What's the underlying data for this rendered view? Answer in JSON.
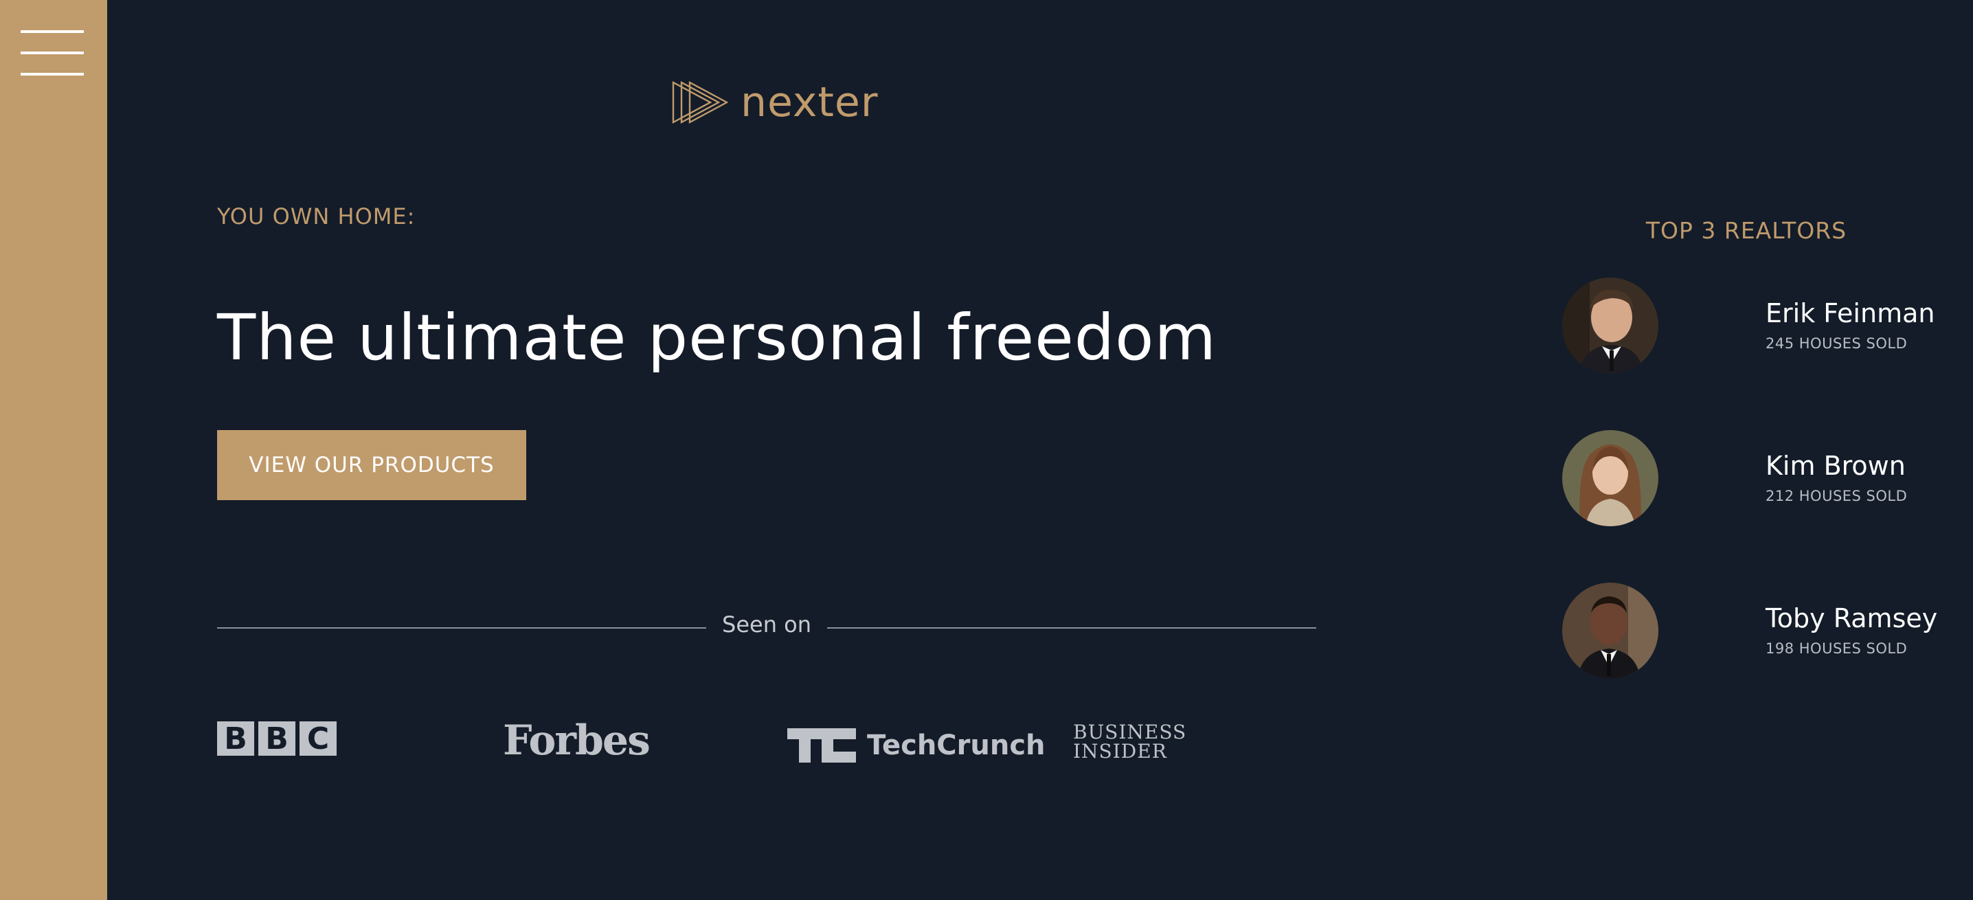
{
  "sidebar": {
    "menu_icon": "hamburger-menu-icon"
  },
  "brand": {
    "name": "nexter",
    "logo_icon": "triple-triangle-play-icon",
    "accent_color": "#c09b6c"
  },
  "hero": {
    "eyebrow": "YOU OWN HOME:",
    "title": "The ultimate personal freedom",
    "cta_label": "VIEW OUR PRODUCTS"
  },
  "seen_on": {
    "label": "Seen on",
    "logos": [
      {
        "name": "BBC",
        "letters": [
          "B",
          "B",
          "C"
        ]
      },
      {
        "name": "Forbes",
        "text": "Forbes"
      },
      {
        "name": "TechCrunch",
        "text": "TechCrunch"
      },
      {
        "name": "Business Insider",
        "text_line1": "Business",
        "text_line2": "Insider"
      }
    ]
  },
  "realtors": {
    "title": "TOP 3 REALTORS",
    "items": [
      {
        "name": "Erik Feinman",
        "sold": "245 HOUSES SOLD"
      },
      {
        "name": "Kim Brown",
        "sold": "212 HOUSES SOLD"
      },
      {
        "name": "Toby Ramsey",
        "sold": "198 HOUSES SOLD"
      }
    ]
  },
  "colors": {
    "background": "#141c29",
    "accent": "#c09b6c",
    "text": "#ffffff",
    "muted": "#bfc2c8"
  }
}
